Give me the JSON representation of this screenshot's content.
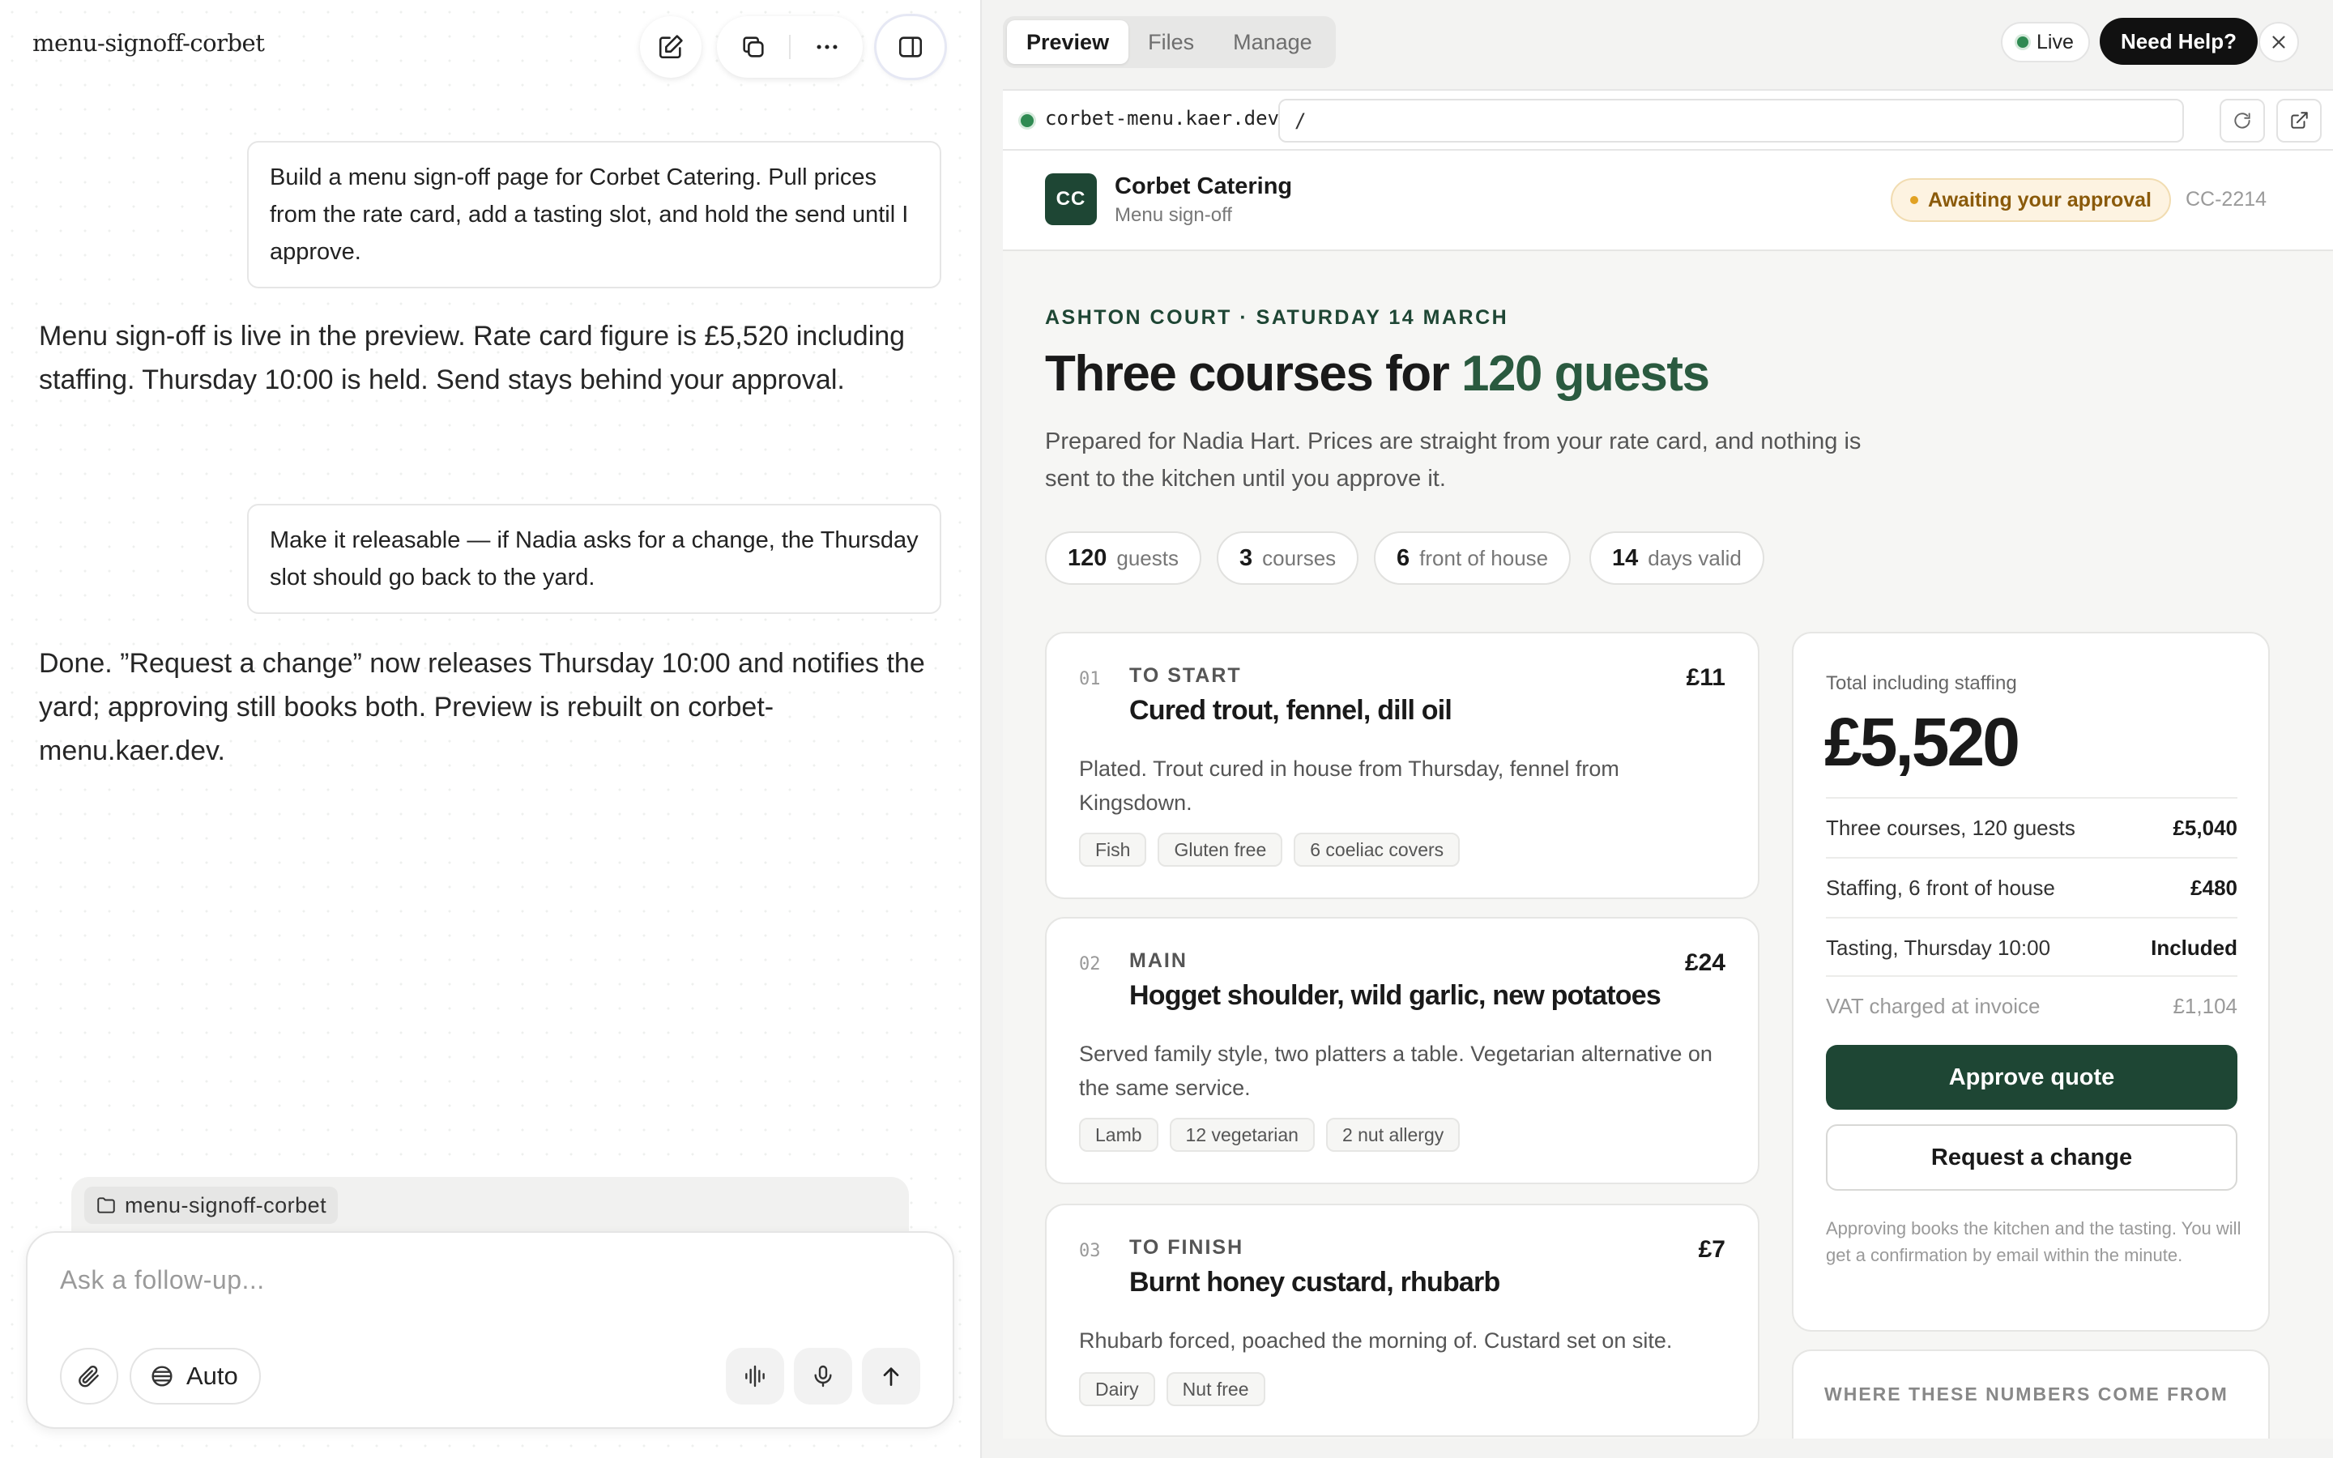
{
  "project": {
    "title": "menu-signoff-corbet"
  },
  "conversation": {
    "messages": [
      {
        "role": "user",
        "text": "Build a menu sign-off page for Corbet Catering. Pull prices from the rate card, add a tasting slot, and hold the send until I approve."
      },
      {
        "role": "assistant",
        "text": "Menu sign-off is live in the preview. Rate card figure is £5,520 including staffing. Thursday 10:00 is held. Send stays behind your approval."
      },
      {
        "role": "user",
        "text": "Make it releasable — if Nadia asks for a change, the Thursday slot should go back to the yard."
      },
      {
        "role": "assistant",
        "text": "Done. ”Request a change” now releases Thursday 10:00 and notifies the yard; approving still books both. Preview is rebuilt on corbet-menu.kaer.dev."
      }
    ]
  },
  "composer": {
    "context_chip": "menu-signoff-corbet",
    "placeholder": "Ask a follow-up...",
    "mode_label": "Auto"
  },
  "preview_panel": {
    "tabs": [
      {
        "label": "Preview",
        "active": true
      },
      {
        "label": "Files",
        "active": false
      },
      {
        "label": "Manage",
        "active": false
      }
    ],
    "live_label": "Live",
    "help_label": "Need Help?",
    "url_host": "corbet-menu.kaer.dev",
    "url_path": "/"
  },
  "site": {
    "logo_initials": "CC",
    "brand": "Corbet Catering",
    "brand_sub": "Menu sign-off",
    "status": "Awaiting your approval",
    "reference": "CC-2214",
    "eyebrow": "ASHTON COURT · SATURDAY 14 MARCH",
    "headline_main": "Three courses for ",
    "headline_accent": "120 guests",
    "lede": "Prepared for Nadia Hart. Prices are straight from your rate card, and nothing is sent to the kitchen until you approve it.",
    "stats": [
      {
        "value": "120",
        "label": "guests"
      },
      {
        "value": "3",
        "label": "courses"
      },
      {
        "value": "6",
        "label": "front of house"
      },
      {
        "value": "14",
        "label": "days valid"
      }
    ],
    "courses": [
      {
        "num": "01",
        "kicker": "TO START",
        "title": "Cured trout, fennel, dill oil",
        "price": "£11",
        "desc": "Plated. Trout cured in house from Thursday, fennel from Kingsdown.",
        "tags": [
          "Fish",
          "Gluten free",
          "6 coeliac covers"
        ]
      },
      {
        "num": "02",
        "kicker": "MAIN",
        "title": "Hogget shoulder, wild garlic, new potatoes",
        "price": "£24",
        "desc": "Served family style, two platters a table. Vegetarian alternative on the same service.",
        "tags": [
          "Lamb",
          "12 vegetarian",
          "2 nut allergy"
        ]
      },
      {
        "num": "03",
        "kicker": "TO FINISH",
        "title": "Burnt honey custard, rhubarb",
        "price": "£7",
        "desc": "Rhubarb forced, poached the morning of. Custard set on site.",
        "tags": [
          "Dairy",
          "Nut free"
        ]
      }
    ],
    "quote": {
      "total_label": "Total including staffing",
      "total": "£5,520",
      "rows": [
        {
          "label": "Three courses, 120 guests",
          "value": "£5,040"
        },
        {
          "label": "Staffing, 6 front of house",
          "value": "£480"
        },
        {
          "label": "Tasting, Thursday 10:00",
          "value": "Included"
        },
        {
          "label": "VAT charged at invoice",
          "value": "£1,104"
        }
      ],
      "approve_label": "Approve quote",
      "change_label": "Request a change",
      "note": "Approving books the kitchen and the tasting. You will get a confirmation by email within the minute."
    },
    "sources_label": "WHERE THESE NUMBERS COME FROM"
  },
  "colors": {
    "brand_green": "#1e4634",
    "accent_green": "#2a5a3f",
    "status_amber": "#e1a223",
    "live_green": "#2f8a52"
  }
}
